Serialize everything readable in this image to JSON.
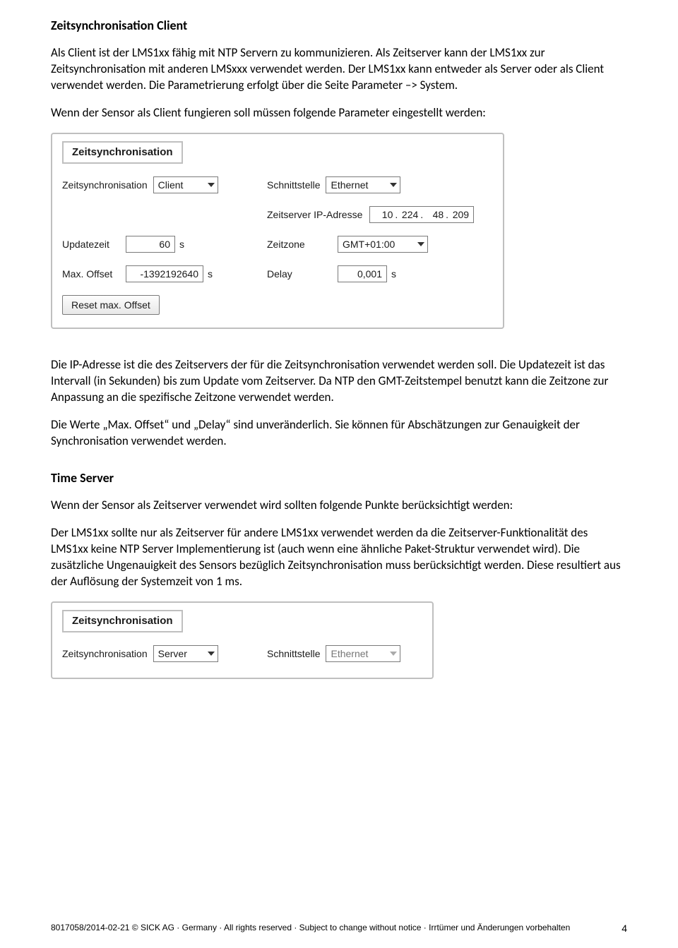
{
  "section1": {
    "heading": "Zeitsynchronisation Client",
    "p1": "Als Client ist der LMS1xx fähig mit NTP Servern zu kommunizieren. Als Zeitserver kann der LMS1xx zur Zeitsynchronisation mit anderen LMSxxx verwendet werden. Der LMS1xx kann entweder als Server oder als Client verwendet werden. Die Parametrierung erfolgt über die Seite Parameter –> System.",
    "p2": "Wenn der Sensor als Client fungieren soll müssen folgende Parameter eingestellt werden:"
  },
  "panel1": {
    "title": "Zeitsynchronisation",
    "zeitsync_label": "Zeitsynchronisation",
    "zeitsync_value": "Client",
    "schnittstelle_label": "Schnittstelle",
    "schnittstelle_value": "Ethernet",
    "ip_label": "Zeitserver IP-Adresse",
    "ip": {
      "o1": "10",
      "o2": "224",
      "o3": "48",
      "o4": "209"
    },
    "updatezeit_label": "Updatezeit",
    "updatezeit_value": "60",
    "updatezeit_unit": "s",
    "zeitzone_label": "Zeitzone",
    "zeitzone_value": "GMT+01:00",
    "maxoffset_label": "Max. Offset",
    "maxoffset_value": "-1392192640",
    "maxoffset_unit": "s",
    "delay_label": "Delay",
    "delay_value": "0,001",
    "delay_unit": "s",
    "reset_btn": "Reset max. Offset"
  },
  "mid": {
    "p1": "Die IP-Adresse ist die des Zeitservers der für die Zeitsynchronisation verwendet werden soll. Die Updatezeit ist das Intervall (in Sekunden) bis zum Update vom Zeitserver. Da NTP den GMT-Zeitstempel benutzt kann die Zeitzone zur Anpassung an die spezifische Zeitzone verwendet werden.",
    "p2": "Die Werte „Max. Offset“ und „Delay“ sind unveränderlich. Sie können für Abschätzungen zur Genauigkeit der Synchronisation verwendet werden."
  },
  "section2": {
    "heading": "Time Server",
    "p1": "Wenn der Sensor als Zeitserver verwendet wird sollten folgende Punkte berücksichtigt werden:",
    "p2": "Der LMS1xx sollte nur als Zeitserver für andere LMS1xx verwendet werden da die Zeitserver-Funktionalität des LMS1xx keine NTP Server Implementierung ist (auch wenn eine ähnliche Paket-Struktur verwendet wird). Die zusätzliche Ungenauigkeit des Sensors bezüglich Zeitsynchronisation muss berücksichtigt werden. Diese resultiert aus der Auflösung der Systemzeit von 1 ms."
  },
  "panel2": {
    "title": "Zeitsynchronisation",
    "zeitsync_label": "Zeitsynchronisation",
    "zeitsync_value": "Server",
    "schnittstelle_label": "Schnittstelle",
    "schnittstelle_value": "Ethernet"
  },
  "footer": {
    "left": "8017058/2014-02-21      © SICK AG · Germany · All rights reserved · Subject to change without notice · Irrtümer und Änderungen vorbehalten",
    "page": "4"
  }
}
